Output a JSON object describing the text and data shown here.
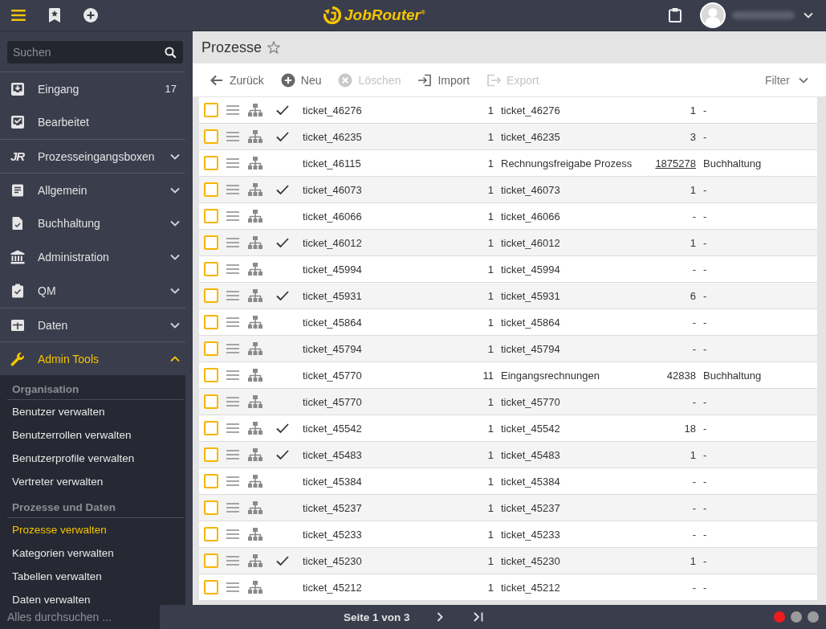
{
  "topbar": {
    "logo": "JobRouter$^{®}$"
  },
  "sidebar": {
    "search": {
      "placeholder": "Suchen"
    },
    "groups": [
      {
        "items": [
          {
            "label": "Eingang",
            "count": "17"
          },
          {
            "label": "Bearbeitet"
          }
        ]
      },
      {
        "items": [
          {
            "label": "Prozesseingangsboxen",
            "icon_text": "JR",
            "expanded": false
          }
        ]
      },
      {
        "items": [
          {
            "label": "Allgemein",
            "expanded": false
          },
          {
            "label": "Buchhaltung",
            "expanded": false
          },
          {
            "label": "Administration",
            "expanded": false
          },
          {
            "label": "QM",
            "expanded": false
          }
        ]
      },
      {
        "items": [
          {
            "label": "Daten",
            "expanded": false
          }
        ]
      },
      {
        "items": [
          {
            "label": "Admin Tools",
            "expanded": true,
            "sections": [
              {
                "heading": "Organisation",
                "items": [
                  {
                    "label": "Benutzer verwalten",
                    "selected": false
                  },
                  {
                    "label": "Benutzerrollen verwalten",
                    "selected": false
                  },
                  {
                    "label": "Benutzerprofile verwalten",
                    "selected": false
                  },
                  {
                    "label": "Vertreter verwalten",
                    "selected": false
                  }
                ]
              },
              {
                "heading": "Prozesse und Daten",
                "items": [
                  {
                    "label": "Prozesse verwalten",
                    "selected": true
                  },
                  {
                    "label": "Kategorien verwalten",
                    "selected": false
                  },
                  {
                    "label": "Tabellen verwalten",
                    "selected": false
                  },
                  {
                    "label": "Daten verwalten",
                    "selected": false
                  }
                ]
              }
            ]
          }
        ]
      }
    ],
    "global_search": {
      "placeholder": "Alles durchsuchen ..."
    }
  },
  "page": {
    "title": "Prozesse",
    "favorite": false
  },
  "toolbar": {
    "buttons": [
      {
        "label": "Zurück",
        "disabled": false
      },
      {
        "label": "Neu",
        "disabled": false
      },
      {
        "label": "Löschen",
        "disabled": true
      },
      {
        "label": "Import",
        "disabled": false
      },
      {
        "label": "Export",
        "disabled": true
      }
    ],
    "filter": {
      "label": "Filter",
      "expanded": false
    }
  },
  "table": {
    "rows": [
      {
        "checked": false,
        "ticked": true,
        "column_1": "ticket_46276",
        "column_2": "1",
        "column_3": "ticket_46276",
        "column_4": "1",
        "column_4_link": false,
        "column_5": "-"
      },
      {
        "checked": false,
        "ticked": true,
        "column_1": "ticket_46235",
        "column_2": "1",
        "column_3": "ticket_46235",
        "column_4": "3",
        "column_4_link": false,
        "column_5": "-"
      },
      {
        "checked": false,
        "ticked": false,
        "column_1": "ticket_46115",
        "column_2": "1",
        "column_3": "Rechnungsfreigabe Prozess",
        "column_4": "1875278",
        "column_4_link": true,
        "column_5": "Buchhaltung"
      },
      {
        "checked": false,
        "ticked": true,
        "column_1": "ticket_46073",
        "column_2": "1",
        "column_3": "ticket_46073",
        "column_4": "1",
        "column_4_link": false,
        "column_5": "-"
      },
      {
        "checked": false,
        "ticked": false,
        "column_1": "ticket_46066",
        "column_2": "1",
        "column_3": "ticket_46066",
        "column_4": "-",
        "column_4_link": false,
        "column_5": "-"
      },
      {
        "checked": false,
        "ticked": true,
        "column_1": "ticket_46012",
        "column_2": "1",
        "column_3": "ticket_46012",
        "column_4": "1",
        "column_4_link": false,
        "column_5": "-"
      },
      {
        "checked": false,
        "ticked": false,
        "column_1": "ticket_45994",
        "column_2": "1",
        "column_3": "ticket_45994",
        "column_4": "-",
        "column_4_link": false,
        "column_5": "-"
      },
      {
        "checked": false,
        "ticked": true,
        "column_1": "ticket_45931",
        "column_2": "1",
        "column_3": "ticket_45931",
        "column_4": "6",
        "column_4_link": false,
        "column_5": "-"
      },
      {
        "checked": false,
        "ticked": false,
        "column_1": "ticket_45864",
        "column_2": "1",
        "column_3": "ticket_45864",
        "column_4": "-",
        "column_4_link": false,
        "column_5": "-"
      },
      {
        "checked": false,
        "ticked": false,
        "column_1": "ticket_45794",
        "column_2": "1",
        "column_3": "ticket_45794",
        "column_4": "-",
        "column_4_link": false,
        "column_5": "-"
      },
      {
        "checked": false,
        "ticked": false,
        "column_1": "ticket_45770",
        "column_2": "11",
        "column_3": "Eingangsrechnungen",
        "column_4": "42838",
        "column_4_link": false,
        "column_5": "Buchhaltung"
      },
      {
        "checked": false,
        "ticked": false,
        "column_1": "ticket_45770",
        "column_2": "1",
        "column_3": "ticket_45770",
        "column_4": "-",
        "column_4_link": false,
        "column_5": "-"
      },
      {
        "checked": false,
        "ticked": true,
        "column_1": "ticket_45542",
        "column_2": "1",
        "column_3": "ticket_45542",
        "column_4": "18",
        "column_4_link": false,
        "column_5": "-"
      },
      {
        "checked": false,
        "ticked": true,
        "column_1": "ticket_45483",
        "column_2": "1",
        "column_3": "ticket_45483",
        "column_4": "1",
        "column_4_link": false,
        "column_5": "-"
      },
      {
        "checked": false,
        "ticked": false,
        "column_1": "ticket_45384",
        "column_2": "1",
        "column_3": "ticket_45384",
        "column_4": "-",
        "column_4_link": false,
        "column_5": "-"
      },
      {
        "checked": false,
        "ticked": false,
        "column_1": "ticket_45237",
        "column_2": "1",
        "column_3": "ticket_45237",
        "column_4": "-",
        "column_4_link": false,
        "column_5": "-"
      },
      {
        "checked": false,
        "ticked": false,
        "column_1": "ticket_45233",
        "column_2": "1",
        "column_3": "ticket_45233",
        "column_4": "-",
        "column_4_link": false,
        "column_5": "-"
      },
      {
        "checked": false,
        "ticked": true,
        "column_1": "ticket_45230",
        "column_2": "1",
        "column_3": "ticket_45230",
        "column_4": "1",
        "column_4_link": false,
        "column_5": "-"
      },
      {
        "checked": false,
        "ticked": false,
        "column_1": "ticket_45212",
        "column_2": "1",
        "column_3": "ticket_45212",
        "column_4": "-",
        "column_4_link": false,
        "column_5": "-"
      }
    ]
  },
  "pagination": {
    "label": "Seite 1 von 3"
  },
  "status_dots": [
    {
      "color": "#ee1c1c"
    },
    {
      "color": "#9b9b9b"
    },
    {
      "color": "#9b9b9b"
    }
  ]
}
